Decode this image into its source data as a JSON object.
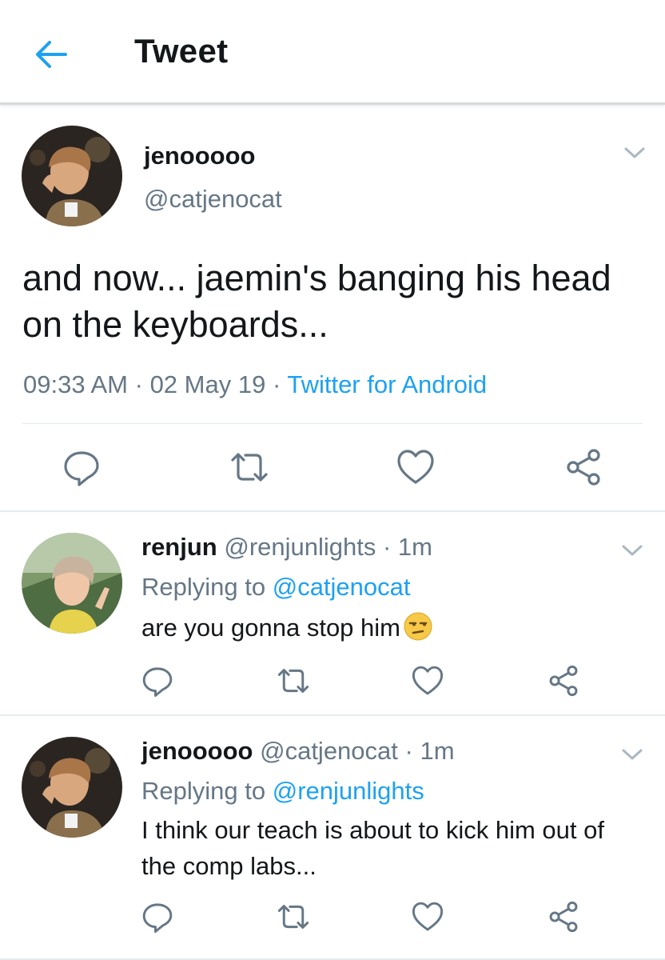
{
  "header": {
    "title": "Tweet",
    "back_icon": "arrow-left-icon"
  },
  "colors": {
    "accent": "#1da1f2",
    "secondary_text": "#657786",
    "primary_text": "#14171a"
  },
  "main_tweet": {
    "display_name": "jenooooo",
    "handle": "@catjenocat",
    "text": "and now... jaemin's banging his head on the keyboards...",
    "time": "09:33 AM",
    "date": "02 May 19",
    "source": "Twitter for Android",
    "dot": "·"
  },
  "replies": [
    {
      "display_name": "renjun",
      "handle": "@renjunlights",
      "time": "· 1m",
      "replying_prefix": "Replying to",
      "replying_to": "@catjenocat",
      "text": "are you gonna stop him",
      "emoji": "unamused-face-icon"
    },
    {
      "display_name": "jenooooo",
      "handle": "@catjenocat",
      "time": "· 1m",
      "replying_prefix": "Replying to",
      "replying_to": "@renjunlights",
      "text": "I think our teach is about to kick him out of the comp labs..."
    }
  ],
  "actions": [
    "reply-icon",
    "retweet-icon",
    "like-icon",
    "share-icon"
  ]
}
